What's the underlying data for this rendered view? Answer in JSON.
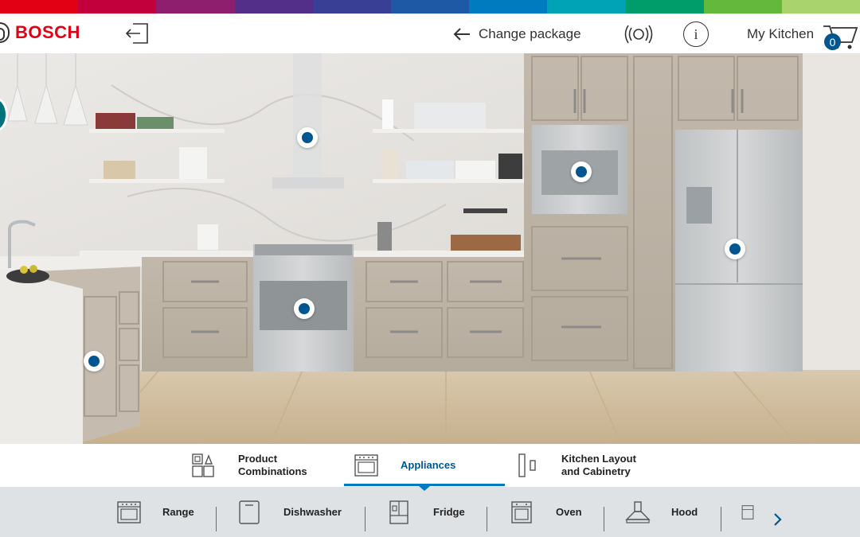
{
  "colors": {
    "rainbow": [
      "#e20015",
      "#c1003c",
      "#8e1f6f",
      "#542f8a",
      "#3a3f96",
      "#1d59a5",
      "#007bc0",
      "#00a2b6",
      "#009c69",
      "#64b83c",
      "#a9d46d"
    ],
    "brand_red": "#e20015",
    "hotspot_blue": "#005691",
    "accent_blue": "#007bc0"
  },
  "header": {
    "brand": "BOSCH",
    "exit_icon": "exit-icon",
    "change_package_label": "Change package",
    "ar_icon": "ar-view-icon",
    "info_icon": "info-icon",
    "info_glyph": "i",
    "my_kitchen_label": "My Kitchen",
    "cart_icon": "cart-icon",
    "cart_count": "0"
  },
  "scene": {
    "hotspots": [
      "hood",
      "wall-oven",
      "fridge",
      "range",
      "island"
    ]
  },
  "tabs": [
    {
      "line1": "Product",
      "line2": "Combinations",
      "icon": "product-combinations-icon",
      "active": false
    },
    {
      "line1": "Appliances",
      "line2": "",
      "icon": "appliances-icon",
      "active": true
    },
    {
      "line1": "Kitchen Layout",
      "line2": "and Cabinetry",
      "icon": "kitchen-layout-icon",
      "active": false
    }
  ],
  "subcategories": [
    {
      "label": "Range",
      "icon": "range-icon"
    },
    {
      "label": "Dishwasher",
      "icon": "dishwasher-icon"
    },
    {
      "label": "Fridge",
      "icon": "fridge-icon"
    },
    {
      "label": "Oven",
      "icon": "oven-icon"
    },
    {
      "label": "Hood",
      "icon": "hood-icon"
    }
  ],
  "subbar": {
    "next_icon": "chevron-right-icon"
  }
}
